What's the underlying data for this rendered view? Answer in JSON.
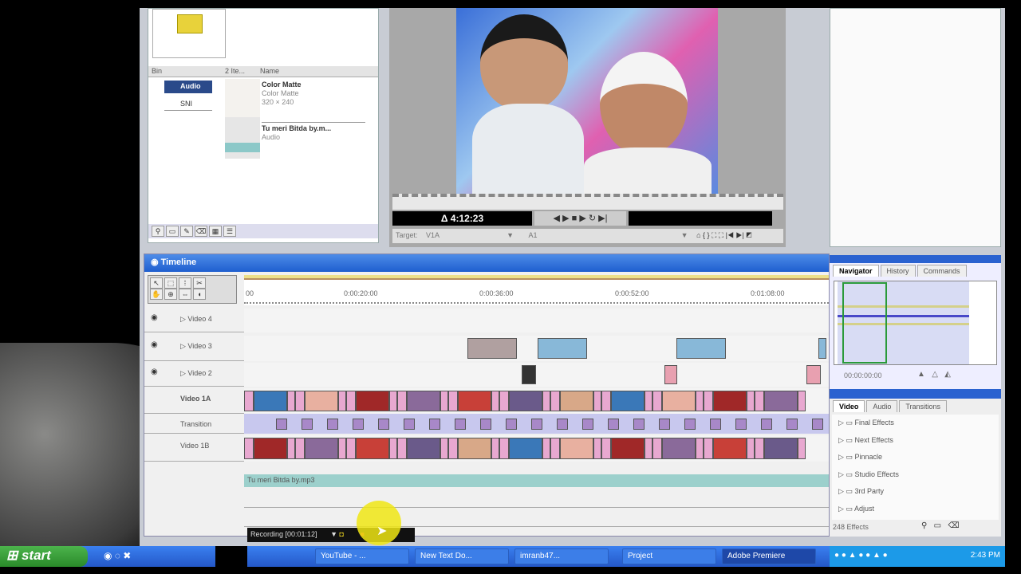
{
  "project": {
    "columns": [
      "Bin",
      "2 Ite...",
      "Name"
    ],
    "bins": [
      "Audio",
      "SNI"
    ],
    "items": [
      {
        "name": "Color Matte",
        "type": "Color Matte",
        "size": "320 × 240"
      },
      {
        "name": "Tu meri Bitda by.m...",
        "type": "Audio"
      }
    ]
  },
  "monitor": {
    "timecode": "Δ 4:12:23",
    "target_label": "Target:",
    "target_video": "V1A",
    "target_audio": "A1"
  },
  "timeline": {
    "title": "Timeline",
    "ruler": [
      "00",
      "0:00:20:00",
      "0:00:36:00",
      "0:00:52:00",
      "0:01:08:00"
    ],
    "tracks": [
      "Video 4",
      "Video 3",
      "Video 2",
      "Video 1A",
      "Transition",
      "Video 1B"
    ],
    "audio_clip": "Tu meri Bitda by.mp3"
  },
  "navigator": {
    "tabs": [
      "Navigator",
      "History",
      "Commands"
    ],
    "timecode": "00:00:00:00"
  },
  "effects": {
    "tabs": [
      "Video",
      "Audio",
      "Transitions"
    ],
    "folders": [
      "Final Effects",
      "Next Effects",
      "Pinnacle",
      "Studio Effects",
      "3rd Party",
      "Adjust"
    ],
    "count": "248 Effects"
  },
  "recorder": {
    "label": "Recording [00:01:12]"
  },
  "taskbar": {
    "start": "start",
    "items": [
      "YouTube - ...",
      "New Text Do...",
      "imranb47...",
      "Project",
      "Adobe Premiere"
    ],
    "clock": "2:43 PM"
  }
}
